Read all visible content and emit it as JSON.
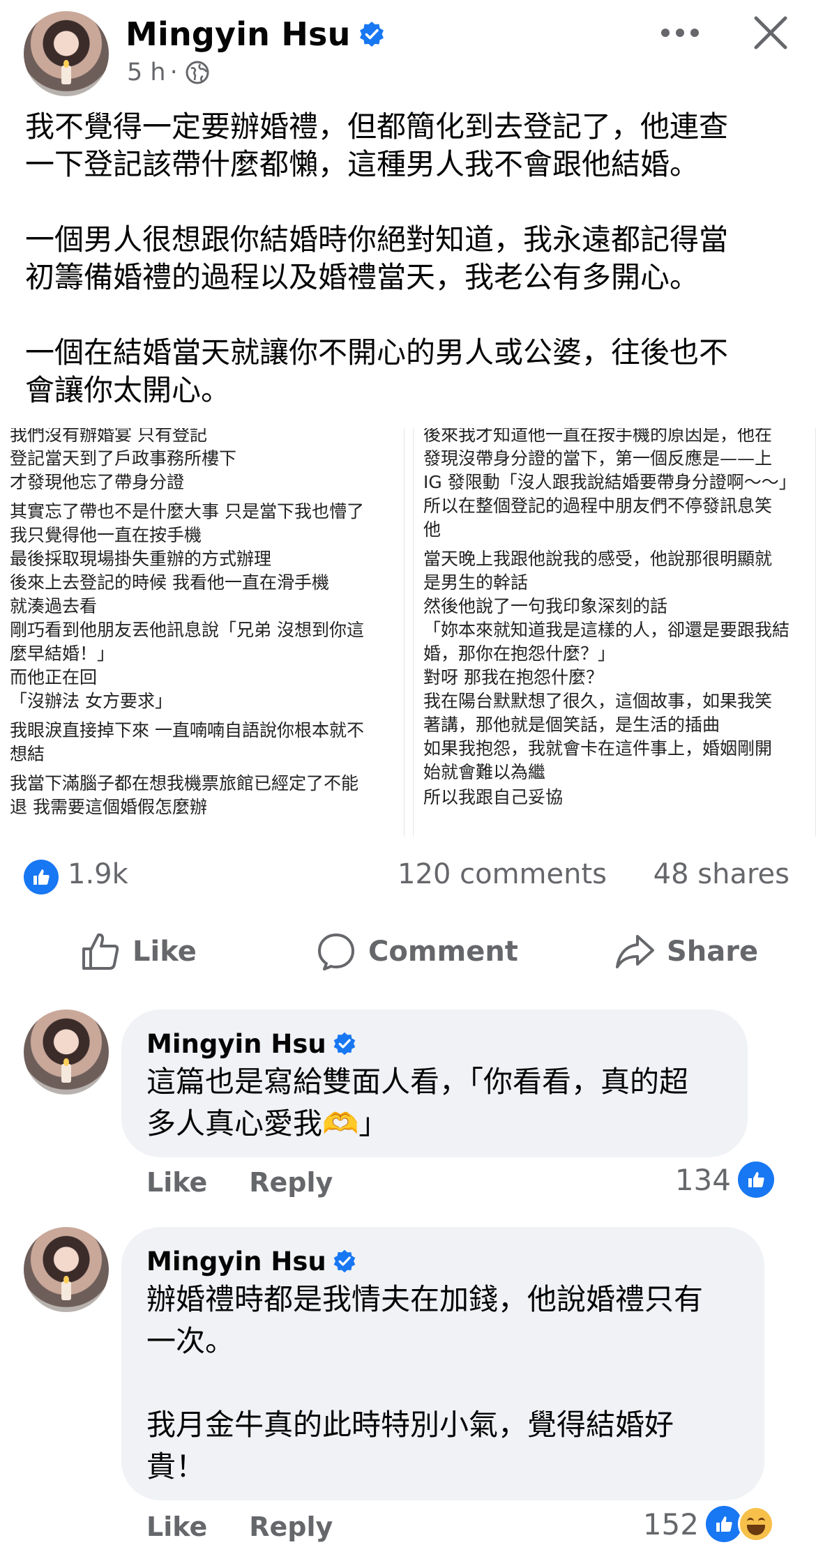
{
  "post": {
    "author": "Mingyin Hsu",
    "time": "5 h",
    "separator": "·",
    "text": "我不覺得一定要辦婚禮，但都簡化到去登記了，他連查\n一下登記該帶什麼都懶，這種男人我不會跟他結婚。\n\n一個男人很想跟你結婚時你絕對知道，我永遠都記得當\n初籌備婚禮的過程以及婚禮當天，我老公有多開心。\n\n一個在結婚當天就讓你不開心的男人或公婆，往後也不\n會讓你太開心。"
  },
  "screenshots": {
    "left_lines": [
      "我們沒有辦婚宴 只有登記",
      "登記當天到了戶政事務所樓下",
      "才發現他忘了帶身分證",
      "其實忘了帶也不是什麼大事 只是當下我也懵了",
      "我只覺得他一直在按手機",
      "最後採取現場掛失重辦的方式辦理",
      "後來上去登記的時候 我看他一直在滑手機",
      "就湊過去看",
      "剛巧看到他朋友丟他訊息說「兄弟 沒想到你這",
      "麼早結婚！」",
      "而他正在回",
      "「沒辦法 女方要求」",
      "我眼淚直接掉下來 一直喃喃自語說你根本就不",
      "想結",
      "我當下滿腦子都在想我機票旅館已經定了不能",
      "退 我需要這個婚假怎麼辦"
    ],
    "right_lines": [
      "後來我才知道他一直在按手機的原因是，他在",
      "發現沒帶身分證的當下，第一個反應是——上",
      "IG 發限動「沒人跟我說結婚要帶身分證啊～～」",
      "所以在整個登記的過程中朋友們不停發訊息笑",
      "他",
      "當天晚上我跟他說我的感受，他說那很明顯就",
      "是男生的幹話",
      "然後他說了一句我印象深刻的話",
      "「妳本來就知道我是這樣的人，卻還是要跟我結",
      "婚，那你在抱怨什麼？」",
      "對呀 那我在抱怨什麼？",
      "我在陽台默默想了很久，這個故事，如果我笑",
      "著講，那他就是個笑話，是生活的插曲",
      "如果我抱怨，我就會卡在這件事上，婚姻剛開",
      "始就會難以為繼",
      "所以我跟自己妥協"
    ]
  },
  "stats": {
    "reactions": "1.9k",
    "comments": "120 comments",
    "shares": "48 shares"
  },
  "actions": {
    "like": "Like",
    "comment": "Comment",
    "share": "Share"
  },
  "comments": [
    {
      "author": "Mingyin Hsu",
      "text": "這篇也是寫給雙面人看，「你看看，真的超\n多人真心愛我🫶」",
      "like": "Like",
      "reply": "Reply",
      "count": "134"
    },
    {
      "author": "Mingyin Hsu",
      "text": "辦婚禮時都是我情夫在加錢，他說婚禮只有\n一次。\n\n我月金牛真的此時特別小氣，覺得結婚好\n貴！",
      "like": "Like",
      "reply": "Reply",
      "count": "152"
    }
  ],
  "colors": {
    "accent": "#1877f2",
    "secondary_text": "#65676b",
    "bubble": "#f0f2f5"
  },
  "icons": [
    "verified-icon",
    "globe-icon",
    "more-icon",
    "close-icon",
    "like-icon",
    "comment-icon",
    "share-icon",
    "haha-icon"
  ]
}
